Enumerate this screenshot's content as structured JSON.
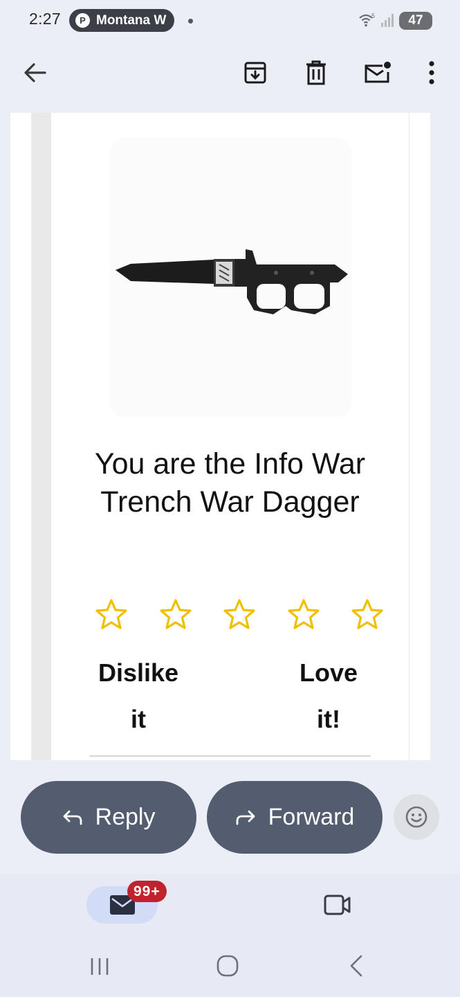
{
  "status_bar": {
    "time": "2:27",
    "notification_app_initial": "P",
    "notification_text": "Montana W",
    "battery": "47"
  },
  "toolbar": {
    "icons": [
      "back-arrow-icon",
      "archive-icon",
      "delete-icon",
      "mark-unread-icon",
      "more-vert-icon"
    ]
  },
  "email": {
    "product_title": "You are the Info War Trench War Dagger",
    "rating": {
      "stars_total": 5,
      "stars_filled": 0,
      "star_color": "#f0c000",
      "dislike_label_line1": "Dislike",
      "dislike_label_line2": "it",
      "love_label_line1": "Love",
      "love_label_line2": "it!"
    }
  },
  "actions": {
    "reply_label": "Reply",
    "forward_label": "Forward",
    "button_color": "#545c70"
  },
  "bottom_nav": {
    "mail_badge": "99+",
    "badge_color": "#c0232b",
    "tabs": [
      "mail-icon",
      "video-icon"
    ]
  },
  "system_nav": {
    "icons": [
      "recents-icon",
      "home-icon",
      "back-icon"
    ]
  }
}
